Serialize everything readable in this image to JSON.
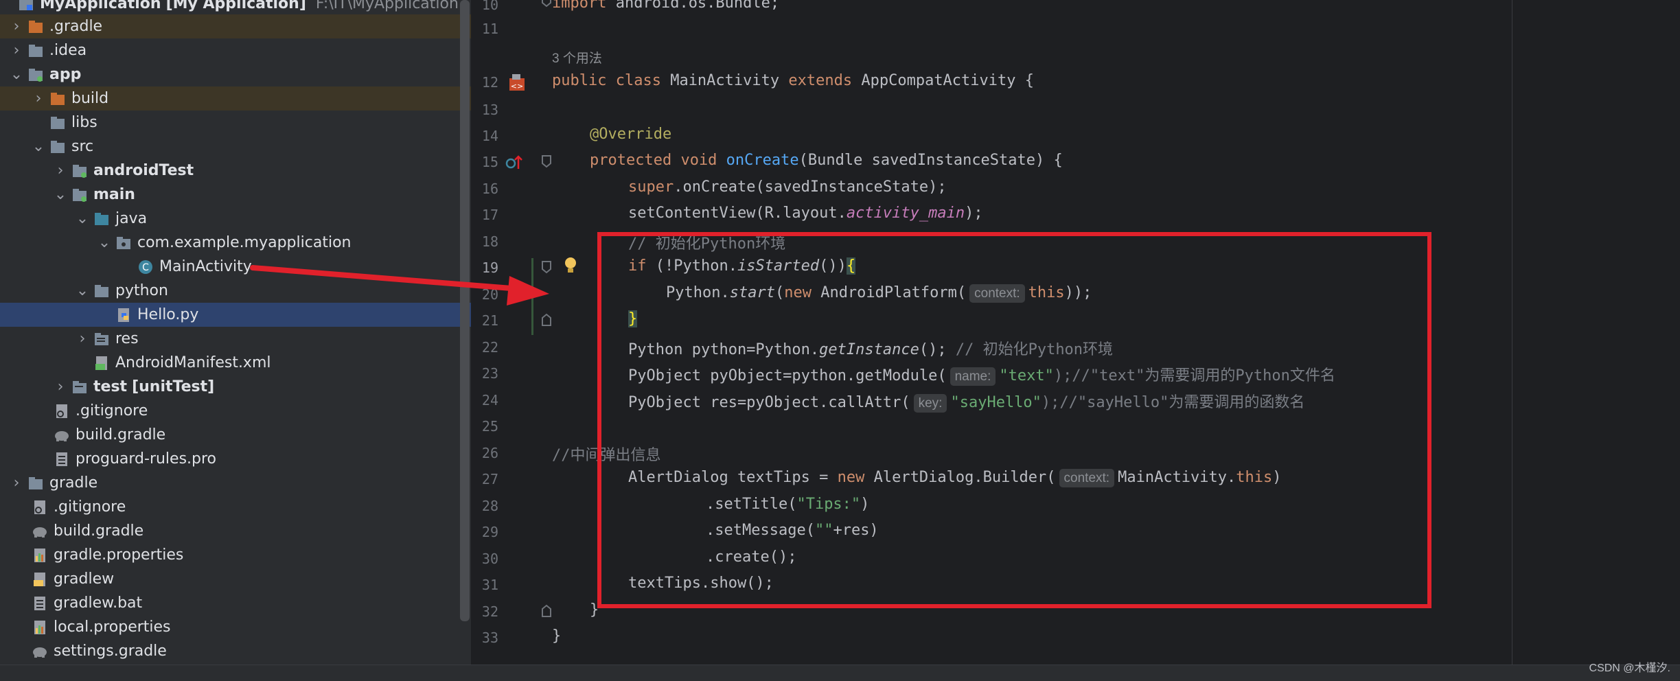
{
  "project_tree": {
    "root_label": "MyApplication",
    "root_module": "[My Application]",
    "root_path": "F:\\IT\\MyApplication",
    "items": [
      {
        "label": ".gradle"
      },
      {
        "label": ".idea"
      },
      {
        "label": "app"
      },
      {
        "label": "build"
      },
      {
        "label": "libs"
      },
      {
        "label": "src"
      },
      {
        "label": "androidTest"
      },
      {
        "label": "main"
      },
      {
        "label": "java"
      },
      {
        "label": "com.example.myapplication"
      },
      {
        "label": "MainActivity"
      },
      {
        "label": "python"
      },
      {
        "label": "Hello.py"
      },
      {
        "label": "res"
      },
      {
        "label": "AndroidManifest.xml"
      },
      {
        "label": "test",
        "suffix": "[unitTest]"
      },
      {
        "label": ".gitignore"
      },
      {
        "label": "build.gradle"
      },
      {
        "label": "proguard-rules.pro"
      },
      {
        "label": "gradle"
      },
      {
        "label": ".gitignore"
      },
      {
        "label": "build.gradle"
      },
      {
        "label": "gradle.properties"
      },
      {
        "label": "gradlew"
      },
      {
        "label": "gradlew.bat"
      },
      {
        "label": "local.properties"
      },
      {
        "label": "settings.gradle"
      }
    ]
  },
  "editor": {
    "line_numbers": [
      "10",
      "11",
      "12",
      "13",
      "14",
      "15",
      "16",
      "17",
      "18",
      "19",
      "20",
      "21",
      "22",
      "23",
      "24",
      "25",
      "26",
      "27",
      "28",
      "29",
      "30",
      "31",
      "32",
      "33"
    ],
    "usage_hint": "3 个用法",
    "code": {
      "l10_kw": "import",
      "l10_rest": " android.os.Bundle;",
      "l12_kw1": "public class",
      "l12_name": " MainActivity ",
      "l12_kw2": "extends",
      "l12_rest": " AppCompatActivity {",
      "l14": "@Override",
      "l15_kw": "protected void",
      "l15_fn": " onCreate",
      "l15_rest": "(Bundle savedInstanceState) {",
      "l16_kw": "super",
      "l16_rest": ".onCreate(savedInstanceState);",
      "l17_a": "setContentView(R.layout.",
      "l17_fld": "activity_main",
      "l17_b": ");",
      "l18": "// 初始化Python环境",
      "l19_kw": "if",
      "l19_a": " (!Python.",
      "l19_it": "isStarted",
      "l19_b": "())",
      "l19_brace": "{",
      "l20_a": "Python.",
      "l20_it": "start",
      "l20_b": "(",
      "l20_kw": "new",
      "l20_c": " AndroidPlatform(",
      "l20_hint": "context:",
      "l20_this": "this",
      "l20_d": "));",
      "l21_brace": "}",
      "l22_a": "Python python=Python.",
      "l22_it": "getInstance",
      "l22_b": "(); ",
      "l22_cm": "// 初始化Python环境",
      "l23_a": "PyObject pyObject=python.getModule(",
      "l23_hint": "name:",
      "l23_str": "\"text\"",
      "l23_cm": ");//\"text\"为需要调用的Python文件名",
      "l24_a": "PyObject res=pyObject.callAttr(",
      "l24_hint": "key:",
      "l24_str": "\"sayHello\"",
      "l24_cm": ");//\"sayHello\"为需要调用的函数名",
      "l26_cm": "//中间弹出信息",
      "l27_a": "AlertDialog textTips = ",
      "l27_kw": "new",
      "l27_b": " AlertDialog.Builder(",
      "l27_hint": "context:",
      "l27_c": "MainActivity.",
      "l27_this": "this",
      "l27_d": ")",
      "l28_a": ".setTitle(",
      "l28_str": "\"Tips:\"",
      "l28_b": ")",
      "l29_a": ".setMessage(",
      "l29_str": "\"\"",
      "l29_b": "+res)",
      "l30": ".create();",
      "l31": "textTips.show();",
      "l32": "}",
      "l33": "}"
    }
  },
  "colors": {
    "annotation_red": "#e1212b",
    "selection": "#2e436e",
    "accent_blue": "#3574f0"
  },
  "watermark": "CSDN @木槿汐."
}
